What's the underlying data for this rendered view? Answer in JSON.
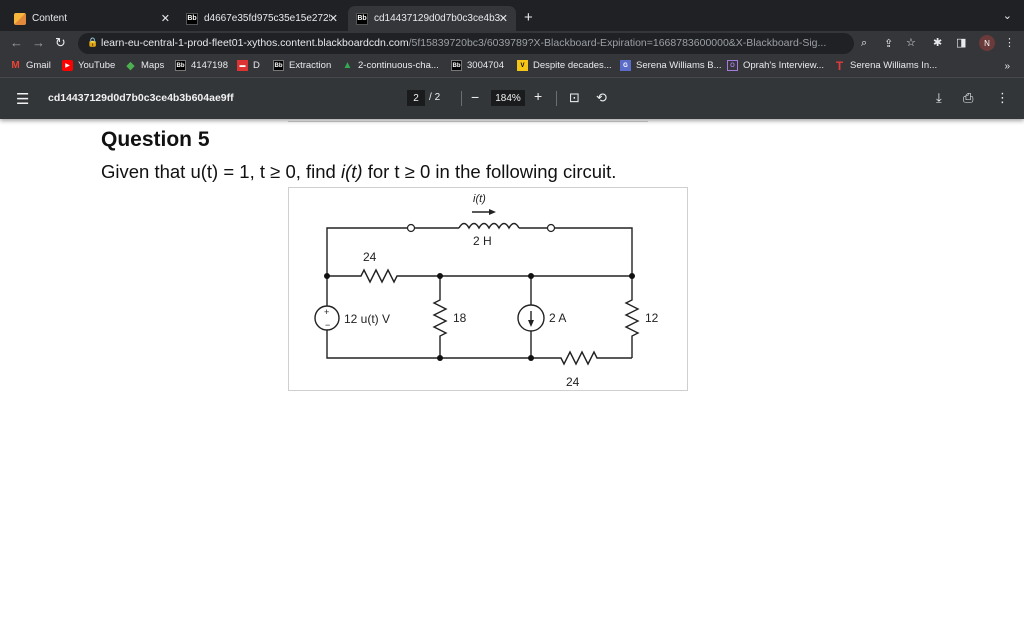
{
  "tabs": [
    {
      "title": "Content",
      "favicon": "pencil-icon"
    },
    {
      "title": "d4667e35fd975c35e15e2725",
      "favicon": "blackboard-icon"
    },
    {
      "title": "cd14437129d0d7b0c3ce4b3b",
      "favicon": "blackboard-icon"
    }
  ],
  "tab_icon_label": "Bb",
  "address": {
    "host": "learn-eu-central-1-prod-fleet01-xythos.content.blackboardcdn.com",
    "path": "/5f15839720bc3/6039789?X-Blackboard-Expiration=1668783600000&X-Blackboard-Sig..."
  },
  "profile_initial": "N",
  "bookmarks": [
    {
      "label": "Gmail",
      "icon": "M"
    },
    {
      "label": "YouTube",
      "icon": "▶"
    },
    {
      "label": "Maps",
      "icon": "◆"
    },
    {
      "label": "4147198",
      "icon": "Bb"
    },
    {
      "label": "D",
      "icon": "▬"
    },
    {
      "label": "Extraction",
      "icon": "Bb"
    },
    {
      "label": "2-continuous-cha...",
      "icon": "▲"
    },
    {
      "label": "3004704",
      "icon": "Bb"
    },
    {
      "label": "Despite decades...",
      "icon": "V"
    },
    {
      "label": "Serena Williams B...",
      "icon": "G"
    },
    {
      "label": "Oprah's Interview...",
      "icon": "O"
    },
    {
      "label": "Serena Williams In...",
      "icon": "T"
    }
  ],
  "pdf": {
    "title": "cd14437129d0d7b0c3ce4b3b604ae9ff",
    "page": "2",
    "page_sep": "/",
    "total_pages": "2",
    "zoom": "184%"
  },
  "question": {
    "title": "Question 5",
    "text_before": "Given that u(t) = 1, t ≥ 0, find ",
    "text_italic": "i(t)",
    "text_after": " for t ≥ 0 in the following circuit."
  },
  "circuit": {
    "current_label": "i(t)",
    "inductor": "2 H",
    "r_top": "24",
    "source": "12 u(t) V",
    "r_mid": "18",
    "current_source": "2 A",
    "r_right": "12",
    "r_bottom": "24"
  }
}
